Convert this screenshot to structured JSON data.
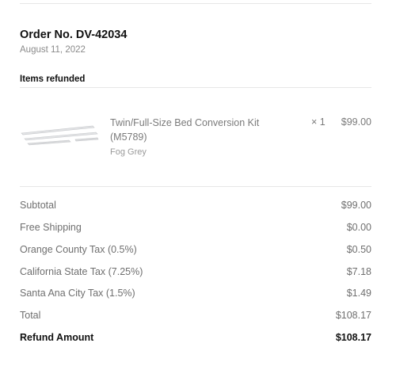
{
  "order": {
    "number_label": "Order No. DV-42034",
    "date": "August 11, 2022"
  },
  "items_section": {
    "title": "Items refunded",
    "items": [
      {
        "name": "Twin/Full-Size Bed Conversion Kit (M5789)",
        "variant": "Fog Grey",
        "quantity": "× 1",
        "price": "$99.00",
        "image_icon": "bed-conversion-rails-image"
      }
    ]
  },
  "summary": {
    "rows": [
      {
        "label": "Subtotal",
        "value": "$99.00"
      },
      {
        "label": "Free Shipping",
        "value": "$0.00"
      },
      {
        "label": "Orange County Tax (0.5%)",
        "value": "$0.50"
      },
      {
        "label": "California State Tax (7.25%)",
        "value": "$7.18"
      },
      {
        "label": "Santa Ana City Tax (1.5%)",
        "value": "$1.49"
      },
      {
        "label": "Total",
        "value": "$108.17"
      }
    ],
    "refund": {
      "label": "Refund Amount",
      "value": "$108.17"
    }
  }
}
